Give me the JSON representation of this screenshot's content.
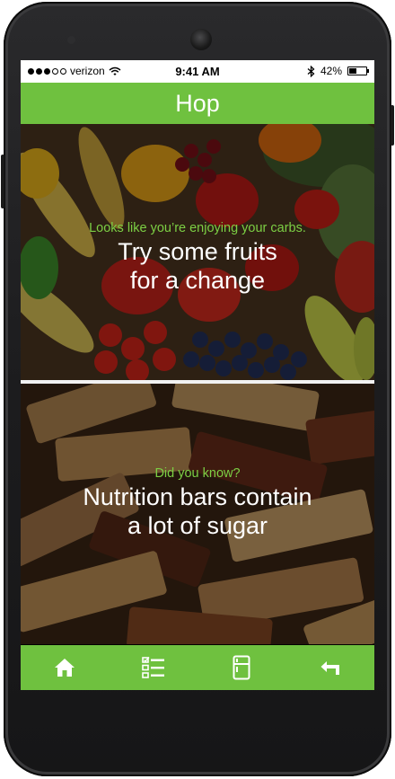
{
  "status_bar": {
    "carrier": "verizon",
    "time": "9:41 AM",
    "battery_percent": "42%",
    "battery_level": 0.42,
    "signal_bars_filled": 3,
    "signal_bars_total": 5
  },
  "app": {
    "title": "Hop",
    "accent_color": "#6fc13f"
  },
  "panels": [
    {
      "image": "fruits-and-vegetables-photo",
      "lead": "Looks like you’re enjoying your carbs.",
      "message_line1": "Try some fruits",
      "message_line2": "for a change"
    },
    {
      "image": "nutrition-bars-photo",
      "lead": "Did you know?",
      "message_line1": "Nutrition bars contain",
      "message_line2": "a lot of sugar"
    }
  ],
  "bottom_nav": [
    {
      "icon": "home-icon"
    },
    {
      "icon": "checklist-icon"
    },
    {
      "icon": "fridge-icon"
    },
    {
      "icon": "back-arrow-icon"
    }
  ]
}
